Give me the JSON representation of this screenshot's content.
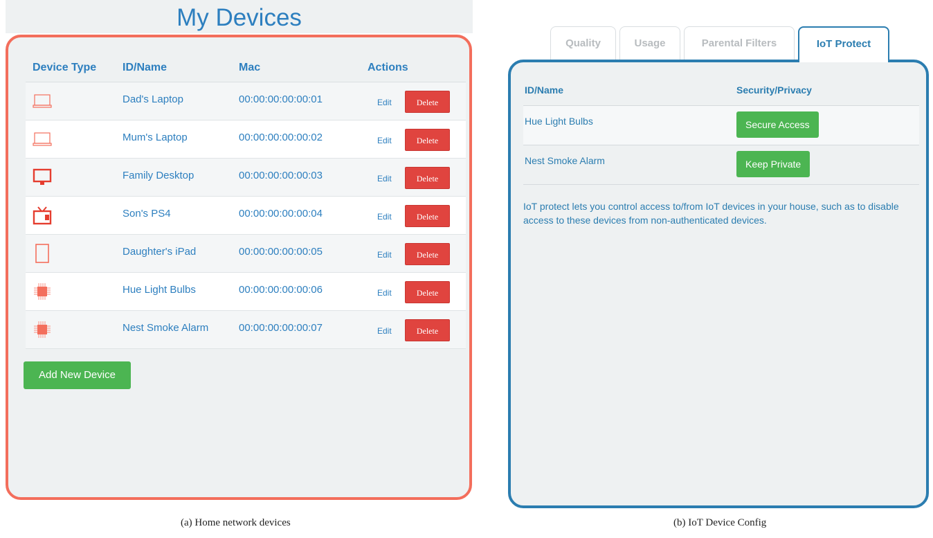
{
  "left": {
    "title": "My Devices",
    "columns": [
      "Device Type",
      "ID/Name",
      "Mac",
      "Actions"
    ],
    "devices": [
      {
        "type_icon": "laptop-icon",
        "name": "Dad's Laptop",
        "mac": "00:00:00:00:00:01",
        "edit": "Edit",
        "delete": "Delete"
      },
      {
        "type_icon": "laptop-icon",
        "name": "Mum's Laptop",
        "mac": "00:00:00:00:00:02",
        "edit": "Edit",
        "delete": "Delete"
      },
      {
        "type_icon": "desktop-icon",
        "name": "Family Desktop",
        "mac": "00:00:00:00:00:03",
        "edit": "Edit",
        "delete": "Delete"
      },
      {
        "type_icon": "tv-icon",
        "name": "Son's PS4",
        "mac": "00:00:00:00:00:04",
        "edit": "Edit",
        "delete": "Delete"
      },
      {
        "type_icon": "tablet-icon",
        "name": "Daughter's iPad",
        "mac": "00:00:00:00:00:05",
        "edit": "Edit",
        "delete": "Delete"
      },
      {
        "type_icon": "chip-icon",
        "name": "Hue Light Bulbs",
        "mac": "00:00:00:00:00:06",
        "edit": "Edit",
        "delete": "Delete"
      },
      {
        "type_icon": "chip-icon",
        "name": "Nest Smoke Alarm",
        "mac": "00:00:00:00:00:07",
        "edit": "Edit",
        "delete": "Delete"
      }
    ],
    "add_button": "Add New Device",
    "caption": "(a) Home network devices"
  },
  "right": {
    "tabs": [
      "Quality",
      "Usage",
      "Parental Filters",
      "IoT Protect"
    ],
    "active_tab": "IoT Protect",
    "columns": [
      "ID/Name",
      "Security/Privacy"
    ],
    "rows": [
      {
        "name": "Hue Light Bulbs",
        "action": "Secure Access"
      },
      {
        "name": "Nest Smoke Alarm",
        "action": "Keep Private"
      }
    ],
    "description": "IoT protect lets you control access to/from IoT devices in your house, such as to disable access to these devices from non-authenticated devices.",
    "caption": "(b) IoT Device Config"
  },
  "colors": {
    "accent_blue": "#2d7fbf",
    "left_border": "#f36e5c",
    "right_border": "#2b7db0",
    "delete_red": "#e0443f",
    "action_green": "#4cb552"
  }
}
